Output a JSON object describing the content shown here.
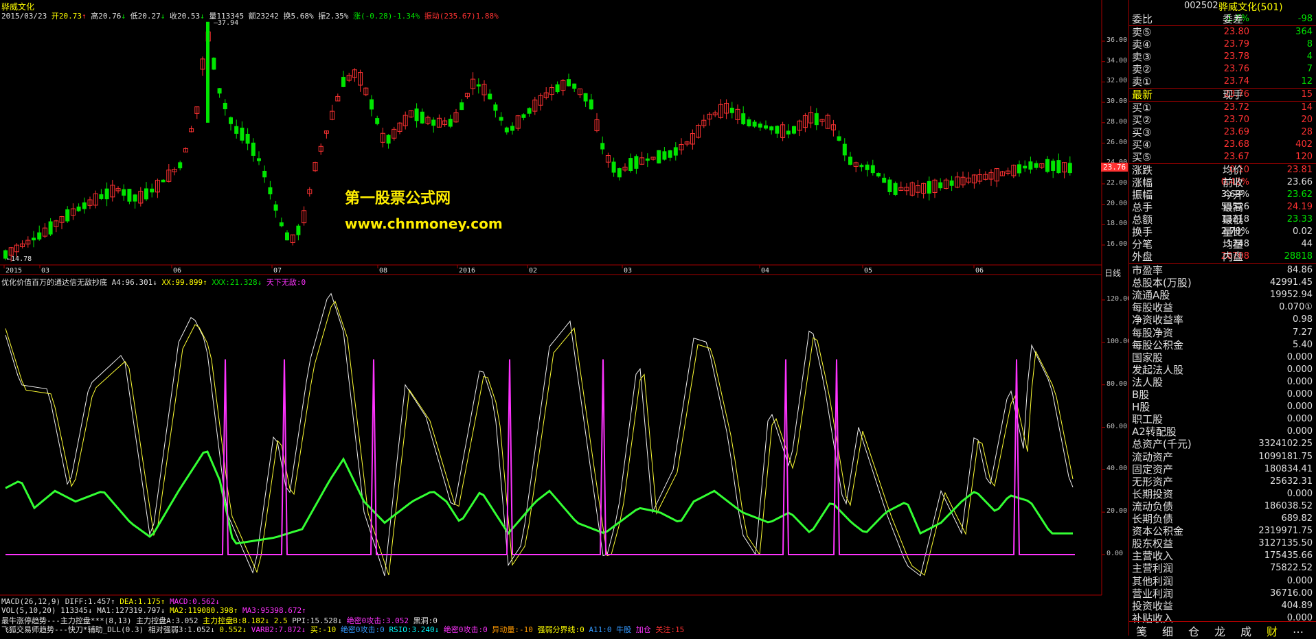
{
  "stock": {
    "name": "骅威文化",
    "code": "002502",
    "title_right": "骅威文化(501)"
  },
  "header": {
    "date": "2015/03/23",
    "open": "开20.73",
    "high": "高20.76",
    "low": "低20.27",
    "close": "收20.53",
    "volume": "量113345",
    "amount": "额23242",
    "turnover": "换5.68%",
    "amplitude": "振2.35%",
    "change": "涨(-0.28)-1.34%",
    "extra": "振动(235.67)1.88%"
  },
  "price_axis": {
    "ticks": [
      "36.00",
      "34.00",
      "32.00",
      "30.00",
      "28.00",
      "26.00",
      "24.00",
      "22.00",
      "20.00",
      "18.00",
      "16.00"
    ],
    "current": "23.76"
  },
  "price_marks": {
    "max": "37.94",
    "min": "14.78"
  },
  "date_axis": [
    "2015",
    "03",
    "06",
    "07",
    "08",
    "2016",
    "02",
    "03",
    "04",
    "05",
    "06"
  ],
  "date_axis_right": "日线",
  "watermark": {
    "cn": "第一股票公式网",
    "url": "www.chnmoney.com"
  },
  "indicator_header": {
    "name": "优化价值百万的通达信无敌抄底",
    "a4": "A4:96.301↓",
    "xx": "XX:99.899↑",
    "xxx": "XXX:21.328↓",
    "tx": "天下无敌:0"
  },
  "ind_axis": [
    "120.00",
    "100.00",
    "80.00",
    "60.00",
    "40.00",
    "20.00",
    "0.00"
  ],
  "bottom_lines": {
    "macd": [
      "MACD(26,12,9)",
      "DIFF:1.457↑",
      "DEA:1.175↑",
      "MACD:0.562↓"
    ],
    "vol": [
      "VOL(5,10,20)",
      "113345↓",
      "MA1:127319.797↓",
      "MA2:119080.398↑",
      "MA3:95398.672↑"
    ],
    "zt": [
      "最牛涨停趋势---主力控盘***(8,13)",
      "主力控盘A:3.052",
      "主力控盘B:8.182↓",
      "2.5",
      "PPI:15.528↓",
      "绝密0攻击:3.052",
      "黑洞:0"
    ],
    "fh": [
      "飞狐交易师趋势---快刀*辅助_DLL(0.3)",
      "相对强弱3:1.052↓",
      "0.552↓",
      "VARB2:7.872↓",
      "买:-10",
      "绝密0攻击:0",
      "RSIO:3.240↓",
      "绝密0攻击:0",
      "异动量:-10",
      "强弱分界线:0",
      "A11:0",
      "牛股",
      "加仓",
      "关注:15"
    ]
  },
  "quote": {
    "webi": {
      "label": "委比",
      "value": "-1.6%",
      "label2": "委差",
      "value2": "-98"
    },
    "sells": [
      {
        "label": "卖⑤",
        "price": "23.80",
        "vol": "364"
      },
      {
        "label": "卖④",
        "price": "23.79",
        "vol": "8"
      },
      {
        "label": "卖③",
        "price": "23.78",
        "vol": "4"
      },
      {
        "label": "卖②",
        "price": "23.76",
        "vol": "7"
      },
      {
        "label": "卖①",
        "price": "23.74",
        "vol": "12"
      }
    ],
    "latest": {
      "label": "最新",
      "price": "23.76",
      "label2": "现手",
      "vol": "15"
    },
    "buys": [
      {
        "label": "买①",
        "price": "23.72",
        "vol": "14"
      },
      {
        "label": "买②",
        "price": "23.70",
        "vol": "20"
      },
      {
        "label": "买③",
        "price": "23.69",
        "vol": "28"
      },
      {
        "label": "买④",
        "price": "23.68",
        "vol": "402"
      },
      {
        "label": "买⑤",
        "price": "23.67",
        "vol": "120"
      }
    ],
    "stats": [
      {
        "l": "涨跌",
        "v": "0.10",
        "l2": "均价",
        "v2": "23.81",
        "c1": "#ff3232",
        "c2": "#ff3232"
      },
      {
        "l": "涨幅",
        "v": "0.42%",
        "l2": "前收",
        "v2": "23.66",
        "c1": "#ff3232",
        "c2": "#e0e0e0"
      },
      {
        "l": "振幅",
        "v": "3.63%",
        "l2": "今开",
        "v2": "23.62",
        "c1": "#e0e0e0",
        "c2": "#00e600"
      },
      {
        "l": "总手",
        "v": "55526",
        "l2": "最高",
        "v2": "24.19",
        "c1": "#e0e0e0",
        "c2": "#ff3232"
      },
      {
        "l": "总额",
        "v": "13218",
        "l2": "最低",
        "v2": "23.33",
        "c1": "#e0e0e0",
        "c2": "#00e600"
      },
      {
        "l": "换手",
        "v": "2.78%",
        "l2": "量比",
        "v2": "0.02",
        "c1": "#e0e0e0",
        "c2": "#e0e0e0"
      },
      {
        "l": "分笔",
        "v": "1248",
        "l2": "均量",
        "v2": "44",
        "c1": "#e0e0e0",
        "c2": "#e0e0e0"
      },
      {
        "l": "外盘",
        "v": "26708",
        "l2": "内盘",
        "v2": "28818",
        "c1": "#ff3232",
        "c2": "#00e600"
      }
    ]
  },
  "finance": [
    {
      "l": "市盈率",
      "v": "84.86"
    },
    {
      "l": "总股本(万股)",
      "v": "42991.45"
    },
    {
      "l": "流通A股",
      "v": "19952.94"
    },
    {
      "l": "每股收益",
      "v": "0.070①"
    },
    {
      "l": "净资收益率",
      "v": "0.98"
    },
    {
      "l": "每股净资",
      "v": "7.27"
    },
    {
      "l": "每股公积金",
      "v": "5.40"
    },
    {
      "l": "国家股",
      "v": "0.000"
    },
    {
      "l": "发起法人股",
      "v": "0.000"
    },
    {
      "l": "法人股",
      "v": "0.000"
    },
    {
      "l": "B股",
      "v": "0.000"
    },
    {
      "l": "H股",
      "v": "0.000"
    },
    {
      "l": "职工股",
      "v": "0.000"
    },
    {
      "l": "A2转配股",
      "v": "0.000"
    },
    {
      "l": "总资产(千元)",
      "v": "3324102.25"
    },
    {
      "l": "流动资产",
      "v": "1099181.75"
    },
    {
      "l": "固定资产",
      "v": "180834.41"
    },
    {
      "l": "无形资产",
      "v": "25632.31"
    },
    {
      "l": "长期投资",
      "v": "0.000"
    },
    {
      "l": "流动负债",
      "v": "186038.52"
    },
    {
      "l": "长期负债",
      "v": "689.82"
    },
    {
      "l": "资本公积金",
      "v": "2319971.75"
    },
    {
      "l": "股东权益",
      "v": "3127135.50"
    },
    {
      "l": "主营收入",
      "v": "175435.66"
    },
    {
      "l": "主营利润",
      "v": "75822.52"
    },
    {
      "l": "其他利润",
      "v": "0.000"
    },
    {
      "l": "营业利润",
      "v": "36716.00"
    },
    {
      "l": "投资收益",
      "v": "404.89"
    },
    {
      "l": "补贴收入",
      "v": "0.000"
    }
  ],
  "tabs": [
    "笺",
    "细",
    "仓",
    "龙",
    "成",
    "财",
    "…"
  ]
}
